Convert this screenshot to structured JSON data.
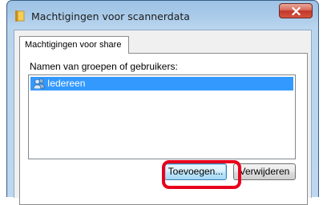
{
  "window": {
    "title": "Machtigingen voor scannerdata",
    "icon": "folder-icon",
    "close_icon": "close-icon"
  },
  "tabs": [
    {
      "label": "Machtigingen voor share",
      "active": true
    }
  ],
  "permissions": {
    "list_label": "Namen van groepen of gebruikers:",
    "items": [
      {
        "label": "Iedereen",
        "icon": "users-icon",
        "selected": true
      }
    ],
    "add_button": "Toevoegen...",
    "remove_button": "Verwijderen"
  },
  "colors": {
    "selection": "#3399ff",
    "highlight_ring": "#e8001c",
    "title_bar": "#a9cae9"
  }
}
